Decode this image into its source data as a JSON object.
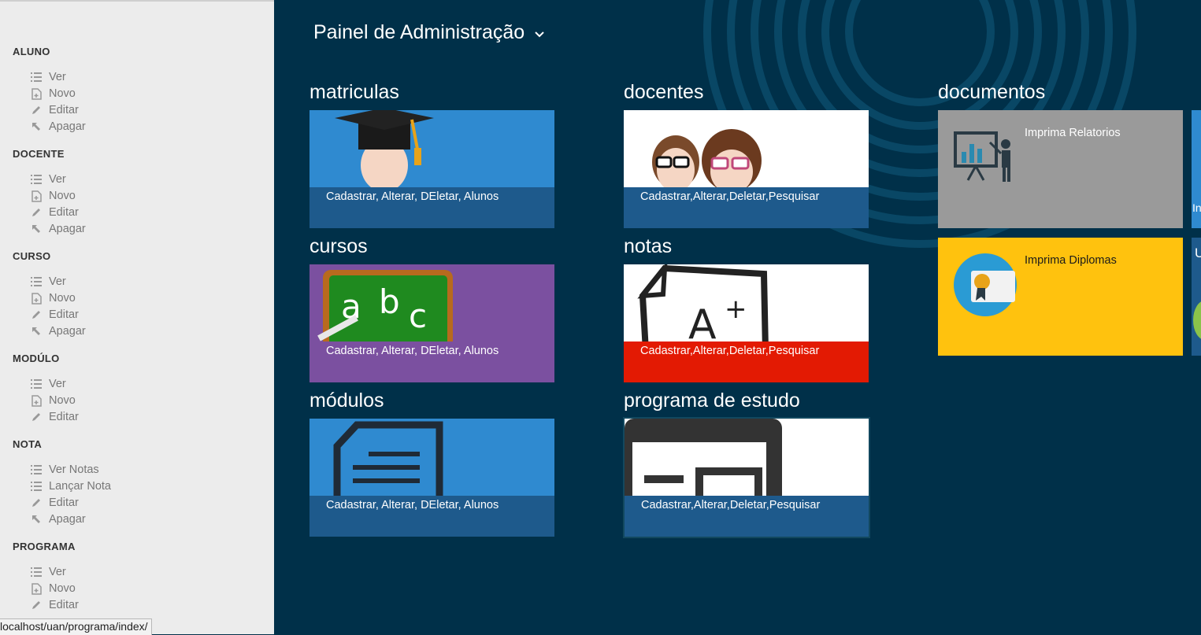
{
  "sidebar": {
    "sections": [
      {
        "title": "ALUNO",
        "items": [
          {
            "icon": "list-icon",
            "label": "Ver"
          },
          {
            "icon": "new-doc-icon",
            "label": "Novo"
          },
          {
            "icon": "pencil-icon",
            "label": "Editar"
          },
          {
            "icon": "delete-arrow-icon",
            "label": "Apagar"
          }
        ]
      },
      {
        "title": "DOCENTE",
        "items": [
          {
            "icon": "list-icon",
            "label": "Ver"
          },
          {
            "icon": "new-doc-icon",
            "label": "Novo"
          },
          {
            "icon": "pencil-icon",
            "label": "Editar"
          },
          {
            "icon": "delete-arrow-icon",
            "label": "Apagar"
          }
        ]
      },
      {
        "title": "CURSO",
        "items": [
          {
            "icon": "list-icon",
            "label": "Ver"
          },
          {
            "icon": "new-doc-icon",
            "label": "Novo"
          },
          {
            "icon": "pencil-icon",
            "label": "Editar"
          },
          {
            "icon": "delete-arrow-icon",
            "label": "Apagar"
          }
        ]
      },
      {
        "title": "MODÚLO",
        "items": [
          {
            "icon": "list-icon",
            "label": "Ver"
          },
          {
            "icon": "new-doc-icon",
            "label": "Novo"
          },
          {
            "icon": "pencil-icon",
            "label": "Editar"
          }
        ]
      },
      {
        "title": "NOTA",
        "items": [
          {
            "icon": "list-icon",
            "label": "Ver Notas"
          },
          {
            "icon": "list-icon",
            "label": "Lançar Nota"
          },
          {
            "icon": "pencil-icon",
            "label": "Editar"
          },
          {
            "icon": "delete-arrow-icon",
            "label": "Apagar"
          }
        ]
      },
      {
        "title": "PROGRAMA",
        "items": [
          {
            "icon": "list-icon",
            "label": "Ver"
          },
          {
            "icon": "new-doc-icon",
            "label": "Novo"
          },
          {
            "icon": "pencil-icon",
            "label": "Editar"
          }
        ]
      }
    ]
  },
  "status_url": "localhost/uan/programa/index/",
  "header": {
    "title": "Painel de Administração"
  },
  "groups": {
    "matriculas": {
      "title": "matriculas",
      "caption": "Cadastrar, Alterar, DEletar, Alunos"
    },
    "docentes": {
      "title": "docentes",
      "caption": "Cadastrar,Alterar,Deletar,Pesquisar"
    },
    "cursos": {
      "title": "cursos",
      "caption": "Cadastrar, Alterar, DEletar, Alunos"
    },
    "notas": {
      "title": "notas",
      "caption": "Cadastrar,Alterar,Deletar,Pesquisar"
    },
    "modulos": {
      "title": "módulos",
      "caption": "Cadastrar, Alterar, DEletar, Alunos"
    },
    "programa": {
      "title": "programa de estudo",
      "caption": "Cadastrar,Alterar,Deletar,Pesquisar"
    },
    "documentos": {
      "title": "documentos",
      "relatorios": "Imprima Relatorios",
      "diplomas": "Imprima Diplomas",
      "cut_label_1": "In",
      "cut_label_2": "U"
    }
  },
  "colors": {
    "background": "#003049",
    "blue_tile": "#2f8ad0",
    "purple_tile": "#7b50a0",
    "red_caption": "#e31a03",
    "caption_blue": "#1e5a8c",
    "gray_tile": "#9a9a9a",
    "yellow_tile": "#ffc20e"
  }
}
